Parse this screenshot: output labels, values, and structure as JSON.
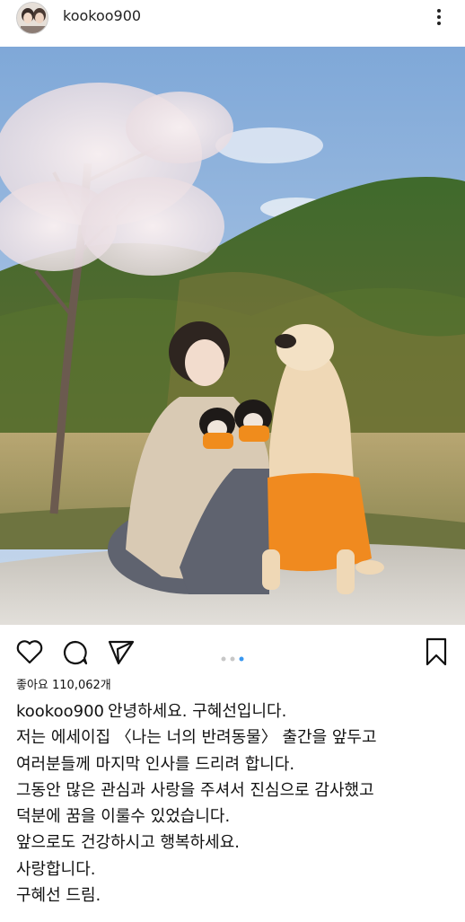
{
  "post": {
    "username": "kookoo900",
    "likes_text": "좋아요 110,062개",
    "carousel_index": 3,
    "carousel_total": 3,
    "caption_lines": [
      "안녕하세요. 구혜선입니다.",
      "저는 에세이집 〈나는 너의 반려동물〉 출간을 앞두고",
      "여러분들께 마지막 인사를 드리려 합니다.",
      "그동안 많은 관심과 사랑을 주셔서 진심으로 감사했고",
      "덕분에 꿈을 이룰수 있었습니다.",
      "앞으로도 건강하시고 행복하세요.",
      "사랑합니다.",
      "구혜선 드림."
    ]
  },
  "icons": {
    "more": "more-vertical-icon",
    "like": "heart-icon",
    "comment": "comment-icon",
    "share": "send-icon",
    "save": "bookmark-icon"
  },
  "colors": {
    "accent": "#3897f0",
    "inactive_dot": "#c7c7c7",
    "text": "#111111"
  }
}
